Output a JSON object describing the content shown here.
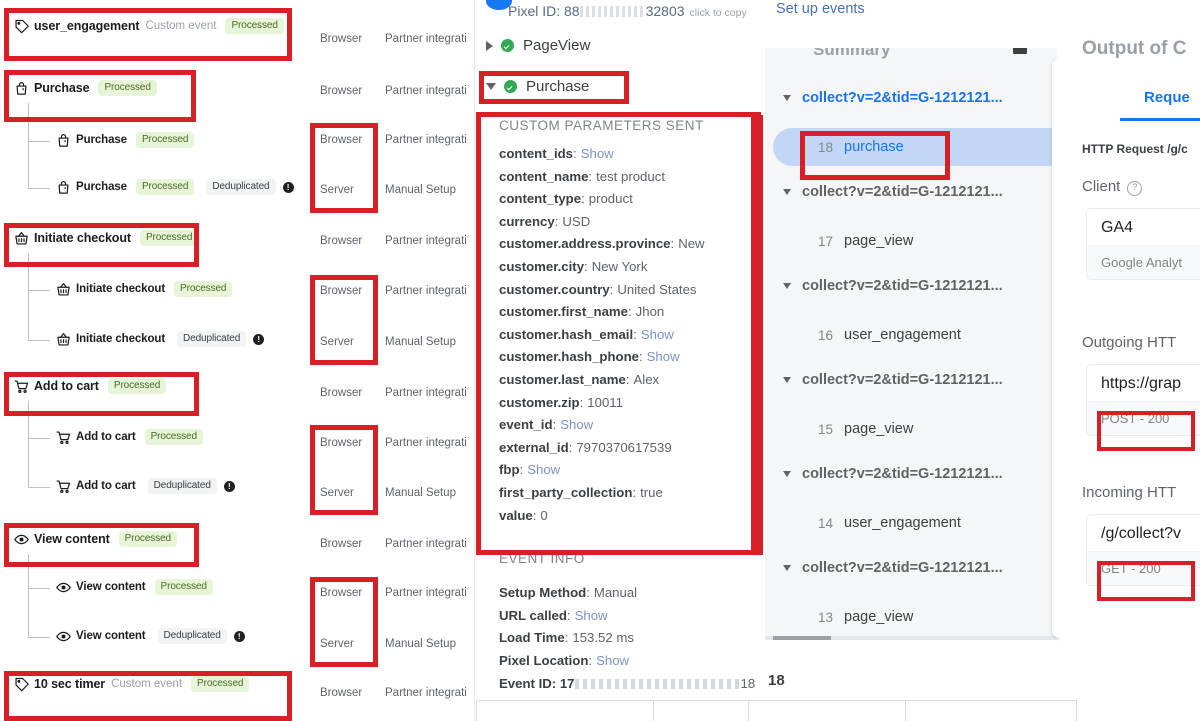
{
  "event_tree": {
    "events": [
      {
        "id": "user_engagement",
        "icon": "tag-icon",
        "name": "user_engagement",
        "type": "Custom event",
        "status": "Processed",
        "highlighted": true,
        "level": 0
      },
      {
        "id": "purchase-parent",
        "icon": "bag-icon",
        "name": "Purchase",
        "type": "",
        "status": "Processed",
        "highlighted": true,
        "level": 0
      },
      {
        "id": "purchase-child-1",
        "icon": "bag-icon",
        "name": "Purchase",
        "type": "",
        "status": "Processed",
        "highlighted": false,
        "level": 1
      },
      {
        "id": "purchase-child-2",
        "icon": "bag-icon",
        "name": "Purchase",
        "type": "",
        "status": "Processed",
        "dedup": "Deduplicated",
        "highlighted": false,
        "level": 1
      },
      {
        "id": "initiate-checkout-parent",
        "icon": "basket-icon",
        "name": "Initiate checkout",
        "type": "",
        "status": "Processed",
        "highlighted": true,
        "level": 0
      },
      {
        "id": "initiate-checkout-child-1",
        "icon": "basket-icon",
        "name": "Initiate checkout",
        "type": "",
        "status": "Processed",
        "highlighted": false,
        "level": 1
      },
      {
        "id": "initiate-checkout-child-2",
        "icon": "basket-icon",
        "name": "Initiate checkout",
        "type": "",
        "status": "",
        "dedup": "Deduplicated",
        "highlighted": false,
        "level": 1
      },
      {
        "id": "add-to-cart-parent",
        "icon": "cart-icon",
        "name": "Add to cart",
        "type": "",
        "status": "Processed",
        "highlighted": true,
        "level": 0
      },
      {
        "id": "add-to-cart-child-1",
        "icon": "cart-icon",
        "name": "Add to cart",
        "type": "",
        "status": "Processed",
        "highlighted": false,
        "level": 1
      },
      {
        "id": "add-to-cart-child-2",
        "icon": "cart-icon",
        "name": "Add to cart",
        "type": "",
        "dedup": "Deduplicated",
        "highlighted": false,
        "level": 1
      },
      {
        "id": "view-content-parent",
        "icon": "eye-icon",
        "name": "View content",
        "type": "",
        "status": "Processed",
        "highlighted": true,
        "level": 0
      },
      {
        "id": "view-content-child-1",
        "icon": "eye-icon",
        "name": "View content",
        "type": "",
        "status": "Processed",
        "highlighted": false,
        "level": 1
      },
      {
        "id": "view-content-child-2",
        "icon": "eye-icon",
        "name": "View content",
        "type": "",
        "dedup": "Deduplicated",
        "highlighted": false,
        "level": 1
      },
      {
        "id": "ten-sec-timer",
        "icon": "tag-icon",
        "name": "10 sec timer",
        "type": "Custom event",
        "status": "Processed",
        "highlighted": true,
        "level": 0
      }
    ],
    "info_glyph": "!"
  },
  "channel_column": {
    "rows": [
      {
        "channel": "Browser",
        "integration": "Partner integrati",
        "highlighted": false
      },
      {
        "channel": "Browser",
        "integration": "Partner integrati",
        "highlighted": false
      },
      {
        "channel": "Browser",
        "integration": "Partner integrati",
        "highlighted": true
      },
      {
        "channel": "Server",
        "integration": "Manual Setup",
        "highlighted": true
      },
      {
        "channel": "Browser",
        "integration": "Partner integrati",
        "highlighted": false
      },
      {
        "channel": "Browser",
        "integration": "Partner integrati",
        "highlighted": true
      },
      {
        "channel": "Server",
        "integration": "Manual Setup",
        "highlighted": true
      },
      {
        "channel": "Browser",
        "integration": "Partner integrati",
        "highlighted": false
      },
      {
        "channel": "Browser",
        "integration": "Partner integrati",
        "highlighted": true
      },
      {
        "channel": "Server",
        "integration": "Manual Setup",
        "highlighted": true
      },
      {
        "channel": "Browser",
        "integration": "Partner integrati",
        "highlighted": false
      },
      {
        "channel": "Browser",
        "integration": "Partner integrati",
        "highlighted": true
      },
      {
        "channel": "Server",
        "integration": "Manual Setup",
        "highlighted": true
      },
      {
        "channel": "Browser",
        "integration": "Partner integrati",
        "highlighted": false
      }
    ]
  },
  "pixel_panel": {
    "pixel_id_prefix": "Pixel ID: 88",
    "pixel_id_suffix": "32803",
    "click_to_copy": "click to copy",
    "set_up_events": "Set up events",
    "events": [
      {
        "name": "PageView",
        "expanded": false,
        "status": "ok"
      },
      {
        "name": "Purchase",
        "expanded": true,
        "status": "ok"
      }
    ],
    "custom_parameters_title": "CUSTOM PARAMETERS SENT",
    "custom_parameters": [
      {
        "key": "content_ids",
        "value": "Show",
        "is_link": true
      },
      {
        "key": "content_name",
        "value": "test product",
        "is_link": false
      },
      {
        "key": "content_type",
        "value": "product",
        "is_link": false
      },
      {
        "key": "currency",
        "value": "USD",
        "is_link": false
      },
      {
        "key": "customer.address.province",
        "value": "New",
        "is_link": false
      },
      {
        "key": "customer.city",
        "value": "New York",
        "is_link": false
      },
      {
        "key": "customer.country",
        "value": "United States",
        "is_link": false
      },
      {
        "key": "customer.first_name",
        "value": "Jhon",
        "is_link": false
      },
      {
        "key": "customer.hash_email",
        "value": "Show",
        "is_link": true
      },
      {
        "key": "customer.hash_phone",
        "value": "Show",
        "is_link": true
      },
      {
        "key": "customer.last_name",
        "value": "Alex",
        "is_link": false
      },
      {
        "key": "customer.zip",
        "value": "10011",
        "is_link": false
      },
      {
        "key": "event_id",
        "value": "Show",
        "is_link": true
      },
      {
        "key": "external_id",
        "value": "7970370617539",
        "is_link": false
      },
      {
        "key": "fbp",
        "value": "Show",
        "is_link": true
      },
      {
        "key": "first_party_collection",
        "value": "true",
        "is_link": false
      },
      {
        "key": "value",
        "value": "0",
        "is_link": false
      }
    ],
    "event_info_title": "EVENT INFO",
    "event_info": [
      {
        "key": "Setup Method",
        "value": "Manual",
        "is_link": false
      },
      {
        "key": "URL called",
        "value": "Show",
        "is_link": true
      },
      {
        "key": "Load Time",
        "value": "153.52 ms",
        "is_link": false
      },
      {
        "key": "Pixel Location",
        "value": "Show",
        "is_link": true
      }
    ],
    "event_id_prefix": "Event ID: 17",
    "event_id_suffix": "18"
  },
  "ga_panel": {
    "summary_label": "Summary",
    "items": [
      {
        "type": "group",
        "label": "collect?v=2&tid=G-1212121...",
        "active": true
      },
      {
        "type": "hit",
        "num": "18",
        "label": "purchase",
        "selected": true
      },
      {
        "type": "group",
        "label": "collect?v=2&tid=G-1212121...",
        "active": false
      },
      {
        "type": "hit",
        "num": "17",
        "label": "page_view",
        "selected": false
      },
      {
        "type": "group",
        "label": "collect?v=2&tid=G-1212121...",
        "active": false
      },
      {
        "type": "hit",
        "num": "16",
        "label": "user_engagement",
        "selected": false
      },
      {
        "type": "group",
        "label": "collect?v=2&tid=G-1212121...",
        "active": false
      },
      {
        "type": "hit",
        "num": "15",
        "label": "page_view",
        "selected": false
      },
      {
        "type": "group",
        "label": "collect?v=2&tid=G-1212121...",
        "active": false
      },
      {
        "type": "hit",
        "num": "14",
        "label": "user_engagement",
        "selected": false
      },
      {
        "type": "group",
        "label": "collect?v=2&tid=G-1212121...",
        "active": false
      },
      {
        "type": "hit",
        "num": "13",
        "label": "page_view",
        "selected": false
      }
    ],
    "bottom_number": "18"
  },
  "sgtm_panel": {
    "title": "Output of C",
    "tab_label": "Reque",
    "http_request": "HTTP Request /g/c",
    "client_label": "Client",
    "help_glyph": "?",
    "client_value": "GA4",
    "client_sub": "Google Analyt",
    "outgoing_label": "Outgoing HTT",
    "outgoing_url": "https://grap",
    "outgoing_status": "POST - 200",
    "incoming_label": "Incoming HTT",
    "incoming_url": "/g/collect?v",
    "incoming_status": "GET - 200"
  },
  "colors": {
    "annotation_red": "#d81f26",
    "processed_bg": "#e6f4d7",
    "processed_text": "#4b6b23",
    "google_blue": "#1a73e8",
    "selected_row": "#c2d7f5",
    "green_check": "#34a853"
  }
}
